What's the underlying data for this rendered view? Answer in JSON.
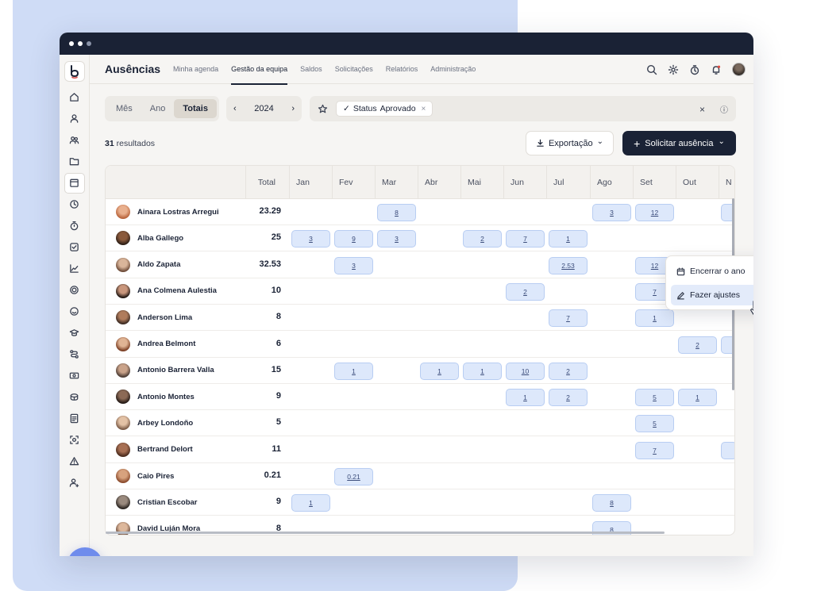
{
  "app": {
    "title": "Ausências",
    "tabs": [
      "Minha agenda",
      "Gestão da equipa",
      "Saldos",
      "Solicitações",
      "Relatórios",
      "Administração"
    ],
    "active_tab": "Gestão da equipa"
  },
  "view": {
    "modes": [
      "Mês",
      "Ano",
      "Totais"
    ],
    "active_mode": "Totais",
    "year": "2024",
    "prev": "‹",
    "next": "›"
  },
  "filter": {
    "chip_check": "✓",
    "chip_label": "Status",
    "chip_value": "Aprovado",
    "chip_remove": "×",
    "clear": "×",
    "info": "ⓘ"
  },
  "results": {
    "count": "31",
    "label": "resultados"
  },
  "actions": {
    "export": "Exportação",
    "request": "Solicitar ausência",
    "plus": "+",
    "chevron": "⌄"
  },
  "table": {
    "columns": [
      "Total",
      "Jan",
      "Fev",
      "Mar",
      "Abr",
      "Mai",
      "Jun",
      "Jul",
      "Ago",
      "Set",
      "Out",
      "N"
    ],
    "rows": [
      {
        "name": "Ainara Lostras Arregui",
        "total": "23.29",
        "cells": {
          "Mar": "8",
          "Ago": "3",
          "Set": "12",
          "N": ""
        }
      },
      {
        "name": "Alba Gallego",
        "total": "25",
        "cells": {
          "Jan": "3",
          "Fev": "9",
          "Mar": "3",
          "Mai": "2",
          "Jun": "7",
          "Jul": "1"
        }
      },
      {
        "name": "Aldo Zapata",
        "total": "32.53",
        "cells": {
          "Fev": "3",
          "Jul": "2.53",
          "Set": "12"
        }
      },
      {
        "name": "Ana Colmena Aulestia",
        "total": "10",
        "cells": {
          "Jun": "2",
          "Set": "7"
        }
      },
      {
        "name": "Anderson Lima",
        "total": "8",
        "cells": {
          "Jul": "7",
          "Set": "1"
        }
      },
      {
        "name": "Andrea Belmont",
        "total": "6",
        "cells": {
          "Out": "2",
          "N": ""
        }
      },
      {
        "name": "Antonio Barrera Valla",
        "total": "15",
        "cells": {
          "Fev": "1",
          "Abr": "1",
          "Mai": "1",
          "Jun": "10",
          "Jul": "2"
        }
      },
      {
        "name": "Antonio Montes",
        "total": "9",
        "cells": {
          "Jun": "1",
          "Jul": "2",
          "Set": "5",
          "Out": "1"
        }
      },
      {
        "name": "Arbey Londoño",
        "total": "5",
        "cells": {
          "Set": "5"
        }
      },
      {
        "name": "Bertrand Delort",
        "total": "11",
        "cells": {
          "Set": "7",
          "N": ""
        }
      },
      {
        "name": "Caio Pires",
        "total": "0.21",
        "cells": {
          "Fev": "0.21"
        }
      },
      {
        "name": "Cristian Escobar",
        "total": "9",
        "cells": {
          "Jan": "1",
          "Ago": "8"
        }
      },
      {
        "name": "David Luján Mora",
        "total": "8",
        "cells": {
          "Ago": "8"
        }
      }
    ]
  },
  "context_menu": {
    "items": [
      "Encerrar o ano",
      "Fazer ajustes"
    ],
    "hover": "Fazer ajustes"
  },
  "colors": {
    "primary": "#1a2235",
    "cell_bg": "#dde8fb",
    "cell_border": "#b8cdf2",
    "backdrop": "#cfdcf6",
    "chat": "#6f8cec"
  }
}
